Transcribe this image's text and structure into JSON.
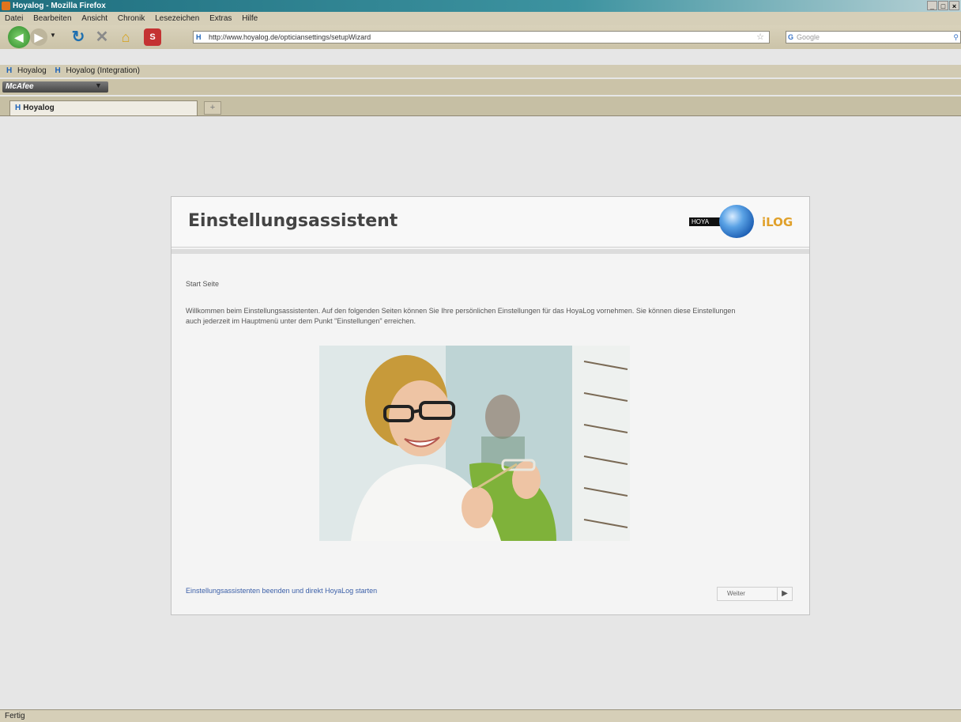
{
  "window": {
    "title": "Hoyalog - Mozilla Firefox",
    "controls": [
      "_",
      "□",
      "×"
    ]
  },
  "menu": [
    "Datei",
    "Bearbeiten",
    "Ansicht",
    "Chronik",
    "Lesezeichen",
    "Extras",
    "Hilfe"
  ],
  "nav": {
    "url": "http://www.hoyalog.de/opticiansettings/setupWizard",
    "search_placeholder": "Google"
  },
  "bookmarks": [
    "Hoyalog",
    "Hoyalog (Integration)"
  ],
  "toolbar": {
    "mcafee_label": "McAfee"
  },
  "tabs": [
    {
      "label": "Hoyalog"
    }
  ],
  "status": "Fertig",
  "wizard": {
    "title": "Einstellungsassistent",
    "logo": {
      "brand": "HOYA",
      "product": "iLOG"
    },
    "section_title": "Start Seite",
    "intro": "Willkommen beim Einstellungsassistenten. Auf den folgenden Seiten können Sie Ihre persönlichen Einstellungen für das HoyaLog vornehmen. Sie können diese Einstellungen auch jederzeit im Hauptmenü unter dem Punkt \"Einstellungen\" erreichen.",
    "skip_link": "Einstellungsassistenten beenden und direkt HoyaLog starten",
    "next_button": "Weiter"
  }
}
